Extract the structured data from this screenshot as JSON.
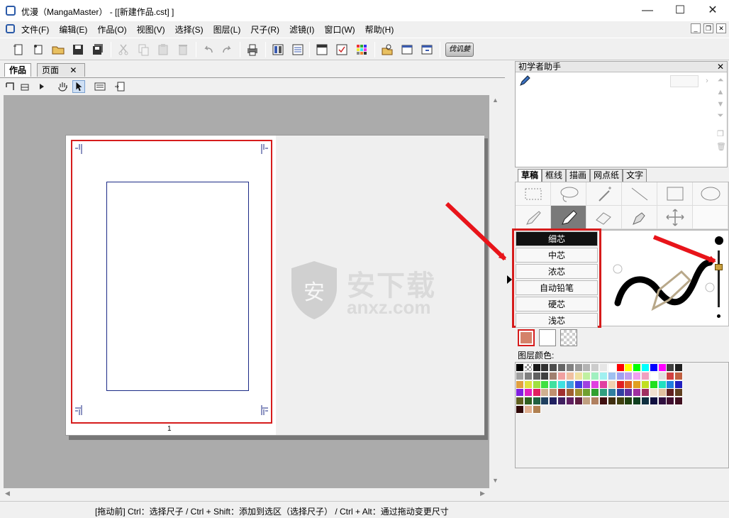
{
  "window": {
    "title": "优漫（MangaMaster） - [[新建作品.cst] ]",
    "minimize": "—",
    "maximize": "☐",
    "close": "✕"
  },
  "menu": {
    "items": [
      "文件(F)",
      "编辑(E)",
      "作品(O)",
      "视图(V)",
      "选择(S)",
      "图层(L)",
      "尺子(R)",
      "滤镜(I)",
      "窗口(W)",
      "帮助(H)"
    ],
    "mdi_minimize": "_",
    "mdi_restore": "❐",
    "mdi_close": "✕"
  },
  "toolbar": {
    "logo": "伐讥婪"
  },
  "document": {
    "tabs": [
      {
        "label": "作品",
        "active": true
      },
      {
        "label": "页面",
        "active": false,
        "close": "✕"
      }
    ],
    "page_number": "1"
  },
  "watermark": {
    "cn": "安下载",
    "en": "anxz.com",
    "shield": "安"
  },
  "helper": {
    "title": "初学者助手",
    "close": "✕"
  },
  "tool_tabs": [
    "草稿",
    "框线",
    "描画",
    "网点纸",
    "文字"
  ],
  "brush_menu": {
    "items": [
      "细芯",
      "中芯",
      "浓芯",
      "自动铅笔",
      "硬芯",
      "浅芯"
    ],
    "selected_index": 0
  },
  "layer_color_label": "图层颜色:",
  "swatches": {
    "main": "#d4826a",
    "secondary": "#ffffff"
  },
  "palette_rows": [
    [
      "#000000",
      "checker",
      "#1a1a1a",
      "#333333",
      "#4d4d4d",
      "#666666",
      "#808080",
      "#999999",
      "#b3b3b3",
      "#cccccc",
      "#e6e6e6",
      "#ffffff",
      "#ff0000",
      "#ffff00",
      "#00ff00",
      "#00ffff",
      "#0000ff",
      "#ff00ff",
      "#404040",
      "#202020"
    ],
    [
      "#a0a0a0",
      "#808080",
      "#606060",
      "#404040",
      "#a08070",
      "#f0a0a0",
      "#f0c0a0",
      "#f0e0a0",
      "#c0f0a0",
      "#a0f0c0",
      "#a0f0f0",
      "#a0c0f0",
      "#a0a0f0",
      "#c0a0f0",
      "#f0a0f0",
      "#f0a0c0",
      "#ffffff",
      "#e0e0e0",
      "#d04040",
      "#c06040"
    ],
    [
      "#e0a040",
      "#e0e040",
      "#a0e040",
      "#40e040",
      "#40e0a0",
      "#40e0e0",
      "#40a0e0",
      "#4040e0",
      "#a040e0",
      "#e040e0",
      "#e040a0",
      "#f0d0b0",
      "#e02020",
      "#e06020",
      "#e0a020",
      "#c0e020",
      "#20e020",
      "#20e0c0",
      "#2080e0",
      "#2020c0"
    ],
    [
      "#8020e0",
      "#e020c0",
      "#e02060",
      "#d0b090",
      "#c09070",
      "#a03030",
      "#a06030",
      "#a09030",
      "#70a030",
      "#30a030",
      "#30a080",
      "#3080a0",
      "#3040a0",
      "#6030a0",
      "#a030a0",
      "#a03060",
      "#f0e0d0",
      "#e0c0a0",
      "#602020",
      "#604020"
    ],
    [
      "#606020",
      "#306020",
      "#206040",
      "#204060",
      "#202060",
      "#402060",
      "#602060",
      "#602040",
      "#c0a080",
      "#b08060",
      "#401010",
      "#403010",
      "#404010",
      "#204010",
      "#104020",
      "#103040",
      "#101040",
      "#301040",
      "#401030",
      "#401020"
    ],
    [
      "#300808",
      "#e0b090",
      "#b08050"
    ]
  ],
  "status": {
    "text": "[拖动前] Ctrl：选择尺子 / Ctrl + Shift：添加到选区（选择尺子） / Ctrl + Alt：通过拖动变更尺寸"
  }
}
